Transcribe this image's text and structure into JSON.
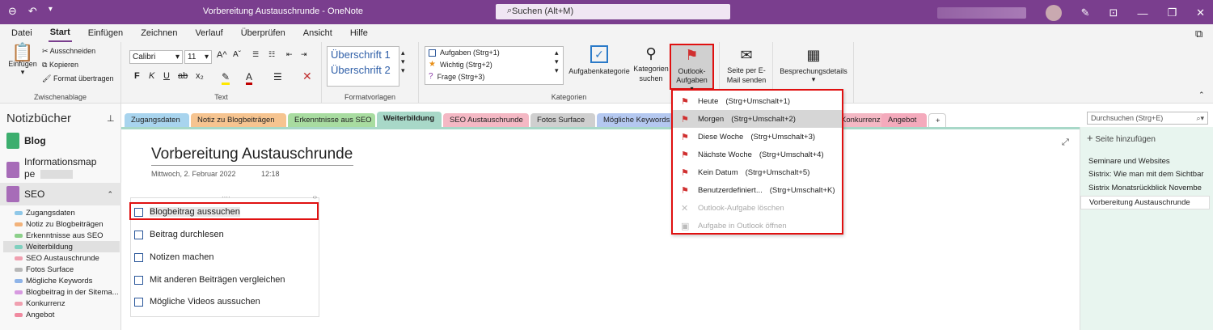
{
  "window": {
    "title": "Vorbereitung Austauschrunde  -  OneNote",
    "search_label": "Suchen (Alt+M)"
  },
  "menu": [
    "Datei",
    "Start",
    "Einfügen",
    "Zeichnen",
    "Verlauf",
    "Überprüfen",
    "Ansicht",
    "Hilfe"
  ],
  "ribbon": {
    "paste_label": "Einfügen",
    "cut_label": "Ausschneiden",
    "copy_label": "Kopieren",
    "format_label": "Format übertragen",
    "clipboard_group": "Zwischenablage",
    "font_name": "Calibri",
    "font_size": "11",
    "text_group": "Text",
    "style1": "Überschrift 1",
    "style2": "Überschrift 2",
    "styles_group": "Formatvorlagen",
    "tag1": "Aufgaben (Strg+1)",
    "tag2": "Wichtig (Strg+2)",
    "tag3": "Frage (Strg+3)",
    "task_category": "Aufgabenkategorie",
    "search_categories": "Kategorien suchen",
    "categories_group": "Kategorien",
    "outlook_tasks": "Outlook-Aufgaben",
    "email_page": "Seite per E-Mail senden",
    "meeting_details": "Besprechungsdetails"
  },
  "notebooks": {
    "header": "Notizbücher",
    "items": [
      {
        "label": "Blog",
        "color": "#3cae6e"
      },
      {
        "label": "Informationsmappe",
        "color": "#a76cb8"
      },
      {
        "label": "SEO",
        "color": "#a76cb8"
      }
    ],
    "sections": [
      {
        "label": "Zugangsdaten",
        "color": "#8fc8e8"
      },
      {
        "label": "Notiz zu Blogbeiträgen",
        "color": "#f2b27a"
      },
      {
        "label": "Erkenntnisse aus SEO",
        "color": "#8cd08a"
      },
      {
        "label": "Weiterbildung",
        "color": "#7fd0bf"
      },
      {
        "label": "SEO Austauschrunde",
        "color": "#f0a0b0"
      },
      {
        "label": "Fotos Surface",
        "color": "#b8b8b8"
      },
      {
        "label": "Mögliche Keywords",
        "color": "#8fb4e8"
      },
      {
        "label": "Blogbeitrag in der Sitema...",
        "color": "#d79ae0"
      },
      {
        "label": "Konkurrenz",
        "color": "#f0a0b0"
      },
      {
        "label": "Angebot",
        "color": "#f08aa0"
      }
    ]
  },
  "tabs": [
    {
      "label": "Zugangsdaten",
      "color": "#a8d4ee"
    },
    {
      "label": "Notiz zu Blogbeiträgen",
      "color": "#f6c490"
    },
    {
      "label": "Erkenntnisse aus SEO",
      "color": "#a8dca0"
    },
    {
      "label": "Weiterbildung",
      "color": "#a8d8c8"
    },
    {
      "label": "SEO Austauschrunde",
      "color": "#f4b8c4"
    },
    {
      "label": "Fotos Surface",
      "color": "#cfcfcf"
    },
    {
      "label": "Mögliche Keywords",
      "color": "#b4c8f0"
    },
    {
      "label": "Konkurrenz",
      "color": "#f4b8c4"
    },
    {
      "label": "Angebot",
      "color": "#f4aabc"
    },
    {
      "label": "+",
      "color": "#ffffff"
    }
  ],
  "page": {
    "title": "Vorbereitung Austauschrunde",
    "date": "Mittwoch, 2. Februar 2022",
    "time": "12:18",
    "todos": [
      "Blogbeitrag aussuchen",
      "Beitrag durchlesen",
      "Notizen machen",
      "Mit anderen Beiträgen vergleichen",
      "Mögliche Videos aussuchen"
    ]
  },
  "right_panel": {
    "search_placeholder": "Durchsuchen (Strg+E)",
    "add_page": "Seite hinzufügen",
    "pages": [
      "Seminare und Websites",
      "Sistrix: Wie man mit dem Sichtbar",
      "Sistrix Monatsrückblick Novembe",
      "Vorbereitung Austauschrunde"
    ]
  },
  "dropdown": [
    {
      "label": "Heute",
      "shortcut": "(Strg+Umschalt+1)",
      "enabled": true
    },
    {
      "label": "Morgen",
      "shortcut": "(Strg+Umschalt+2)",
      "enabled": true
    },
    {
      "label": "Diese Woche",
      "shortcut": "(Strg+Umschalt+3)",
      "enabled": true
    },
    {
      "label": "Nächste Woche",
      "shortcut": "(Strg+Umschalt+4)",
      "enabled": true
    },
    {
      "label": "Kein Datum",
      "shortcut": "(Strg+Umschalt+5)",
      "enabled": true
    },
    {
      "label": "Benutzerdefiniert...",
      "shortcut": "(Strg+Umschalt+K)",
      "enabled": true
    },
    {
      "label": "Outlook-Aufgabe löschen",
      "shortcut": "",
      "enabled": false
    },
    {
      "label": "Aufgabe in Outlook öffnen",
      "shortcut": "",
      "enabled": false
    }
  ]
}
